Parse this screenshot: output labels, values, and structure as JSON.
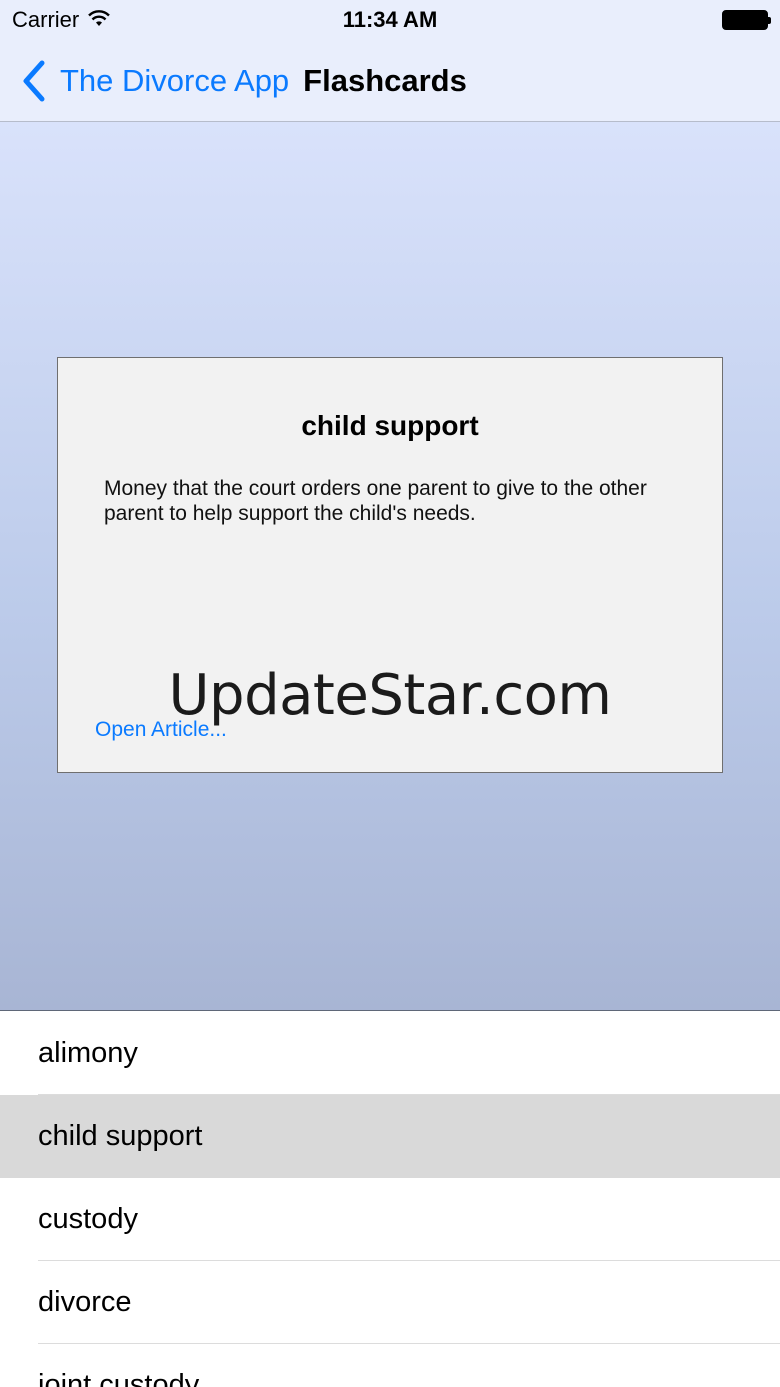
{
  "status_bar": {
    "carrier": "Carrier",
    "time": "11:34 AM",
    "icons": [
      "wifi-icon",
      "battery-icon"
    ]
  },
  "nav": {
    "back_label": "The Divorce App",
    "title": "Flashcards"
  },
  "flashcard": {
    "term": "child support",
    "definition": "Money that the court orders one parent to give to the other parent to help support the child's needs.",
    "link": "Open Article...",
    "watermark": "UpdateStar.com"
  },
  "terms": [
    {
      "label": "alimony",
      "selected": false
    },
    {
      "label": "child support",
      "selected": true
    },
    {
      "label": "custody",
      "selected": false
    },
    {
      "label": "divorce",
      "selected": false
    },
    {
      "label": "joint custody",
      "selected": false
    }
  ],
  "colors": {
    "accent": "#0a7aff",
    "nav_background": "#e9eefc",
    "selected_row": "#d9d9d9"
  }
}
